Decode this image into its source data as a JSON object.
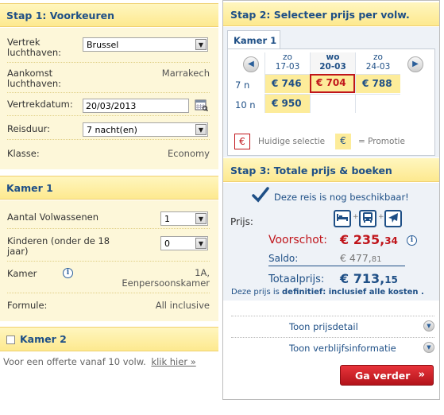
{
  "left": {
    "step1": {
      "title": "Stap 1: Voorkeuren",
      "departure_label": "Vertrek luchthaven:",
      "departure_value": "Brussel",
      "arrival_label": "Aankomst luchthaven:",
      "arrival_value": "Marrakech",
      "date_label": "Vertrekdatum:",
      "date_value": "20/03/2013",
      "duration_label": "Reisduur:",
      "duration_value": "7 nacht(en)",
      "class_label": "Klasse:",
      "class_value": "Economy"
    },
    "room1": {
      "title": "Kamer 1",
      "adults_label": "Aantal Volwassenen",
      "adults_value": "1",
      "children_label": "Kinderen (onder de 18 jaar)",
      "children_value": "0",
      "room_label": "Kamer",
      "room_value_1": "1A,",
      "room_value_2": "Eenpersoonskamer",
      "formula_label": "Formule:",
      "formula_value": "All inclusive"
    },
    "room2": {
      "title": "Kamer 2",
      "checked": false
    },
    "offer_text": "Voor een offerte vanaf 10 volw.",
    "offer_link": "klik hier »"
  },
  "right": {
    "step2": {
      "title": "Stap 2: Selecteer prijs per volw.",
      "tab_label": "Kamer 1",
      "dates": [
        {
          "day": "zo",
          "date": "17-03"
        },
        {
          "day": "wo",
          "date": "20-03"
        },
        {
          "day": "zo",
          "date": "24-03"
        }
      ],
      "rows": [
        {
          "label": "7 n",
          "prices": [
            "€ 746",
            "€ 704",
            "€ 788"
          ]
        },
        {
          "label": "10 n",
          "prices": [
            "€ 950",
            "",
            ""
          ]
        }
      ],
      "legend_current_symbol": "€",
      "legend_current": "Huidige selectie",
      "legend_promo_symbol": "€",
      "legend_promo": "= Promotie"
    },
    "step3": {
      "title": "Stap 3: Totale prijs & boeken",
      "available": "Deze reis is nog beschikbaar!",
      "price_label": "Prijs:",
      "deposit_label": "Voorschot:",
      "deposit_main": "€ 235,",
      "deposit_cents": "34",
      "balance_label": "Saldo:",
      "balance_main": "€ 477,",
      "balance_cents": "81",
      "total_label": "Totaalprijs:",
      "total_main": "€ 713,",
      "total_cents": "15",
      "note_prefix": "Deze prijs is ",
      "note_def": "definitief",
      "note_suffix": ": inclusief alle kosten .",
      "price_detail": "Toon prijsdetail",
      "stay_info": "Toon verblijfsinformatie",
      "continue": "Ga verder"
    }
  },
  "colors": {
    "header_bg": "#fde98f",
    "panel_bg": "#fdf7d9",
    "accent_blue": "#1e4f86",
    "accent_red": "#c0151b",
    "promo_yellow": "#fdec9a"
  },
  "icons": {
    "calendar": "calendar-icon",
    "info": "info-icon",
    "check": "checkmark-icon",
    "hotel": "hotel-bed-icon",
    "bus": "bus-icon",
    "plane": "plane-icon"
  }
}
